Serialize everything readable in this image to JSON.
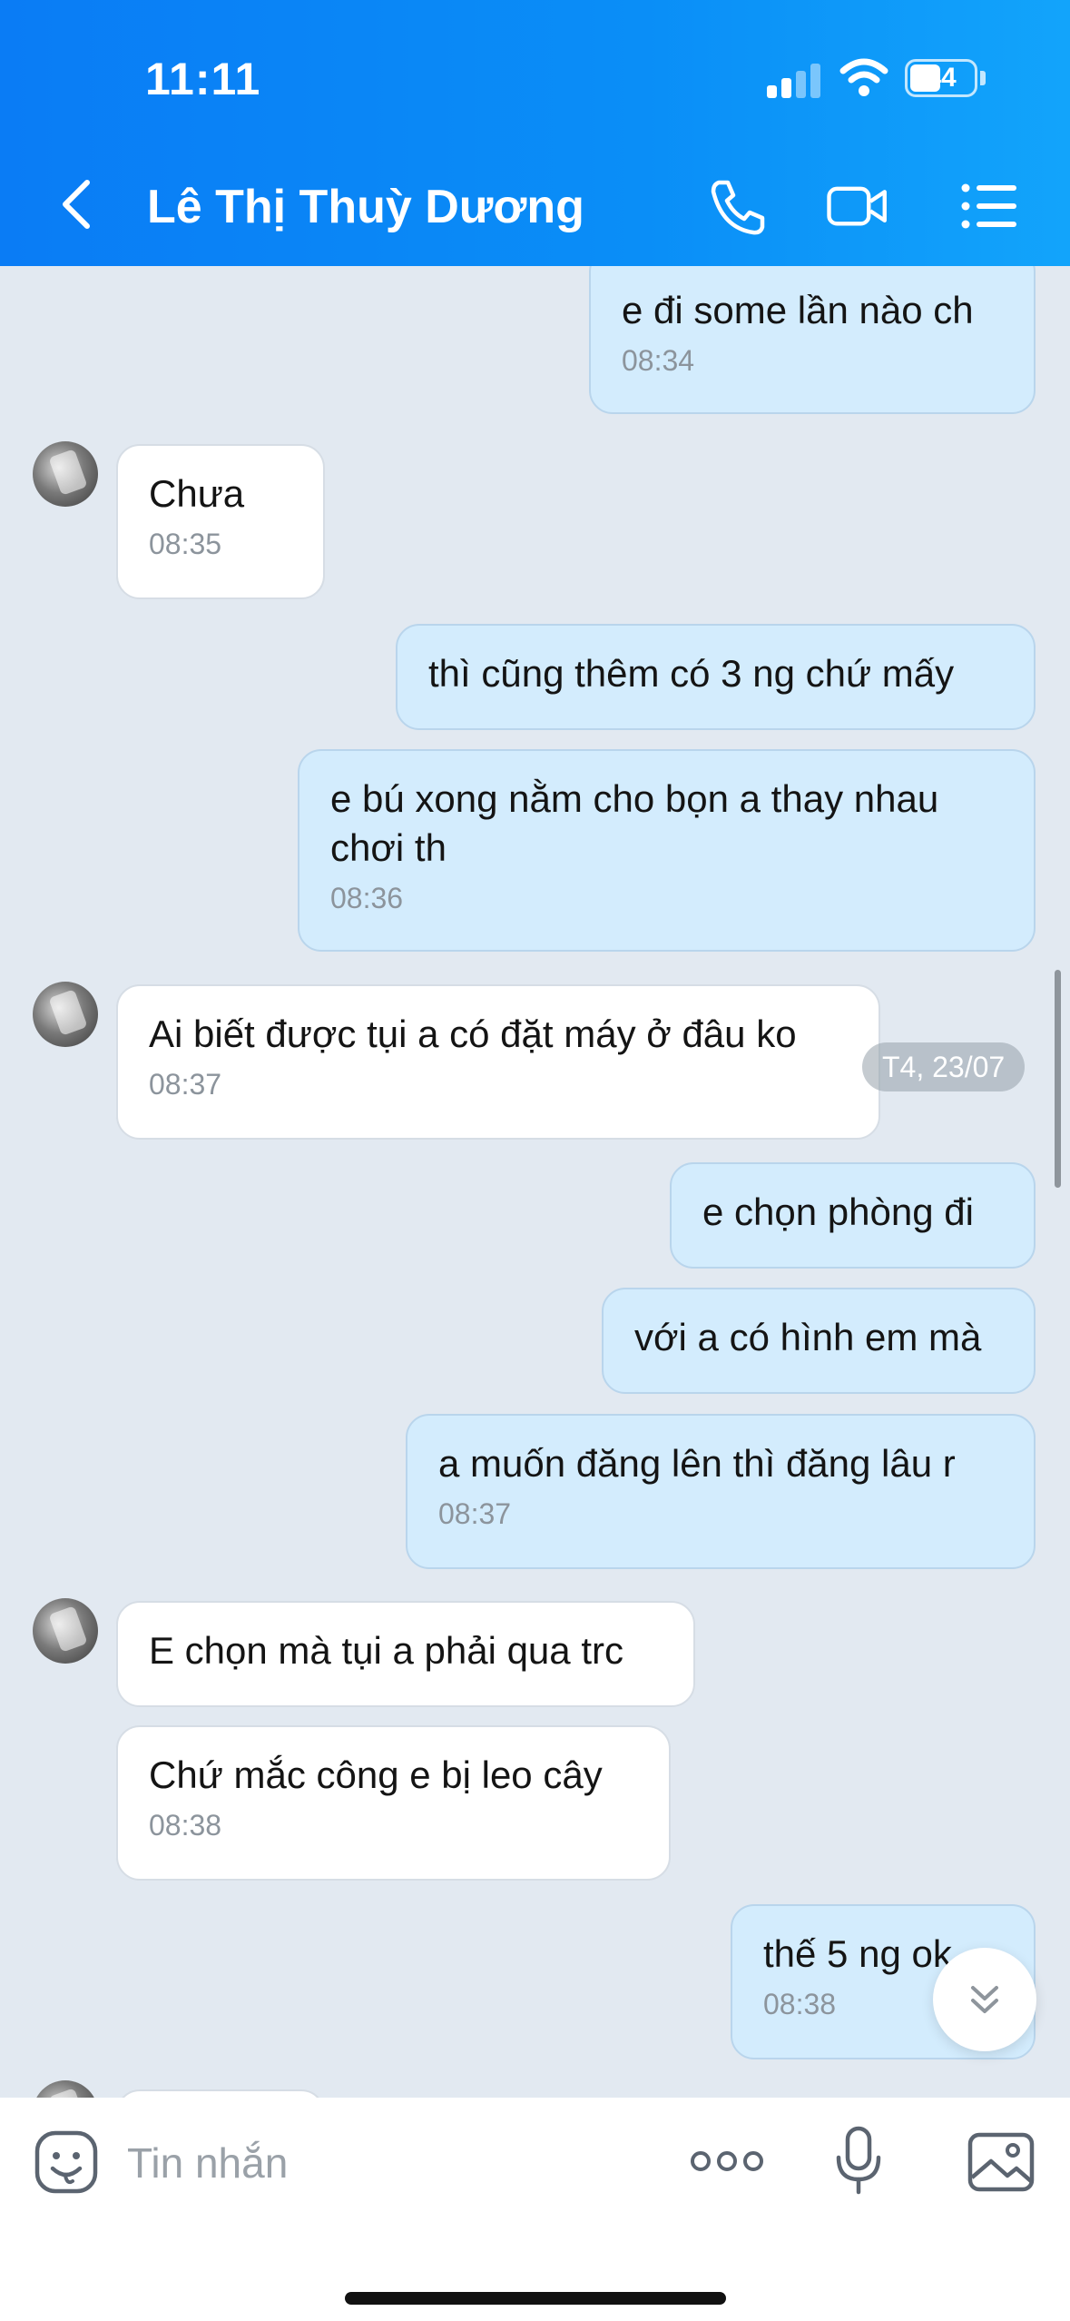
{
  "status_bar": {
    "time": "11:11",
    "battery": "44",
    "battery_level": 0.44
  },
  "header": {
    "contact_name": "Lê Thị Thuỳ Dương",
    "icons": [
      "back-icon",
      "phone-icon",
      "video-call-icon",
      "menu-list-icon"
    ]
  },
  "chat": {
    "date_divider": "T4, 23/07",
    "messages": [
      {
        "dir": "out",
        "text": "e đi some lần nào ch",
        "time": "08:34"
      },
      {
        "dir": "in",
        "text": "Chưa",
        "time": "08:35"
      },
      {
        "dir": "out",
        "text": "thì cũng thêm có 3 ng chứ mấy",
        "time": ""
      },
      {
        "dir": "out",
        "text": "e bú xong nằm cho bọn a thay nhau chơi th",
        "time": "08:36"
      },
      {
        "dir": "in",
        "text": "Ai biết được tụi a có đặt máy ở đâu ko",
        "time": "08:37"
      },
      {
        "dir": "out",
        "text": "e chọn phòng đi",
        "time": ""
      },
      {
        "dir": "out",
        "text": "với a có hình em mà",
        "time": ""
      },
      {
        "dir": "out",
        "text": "a muốn đăng lên thì đăng lâu r",
        "time": "08:37"
      },
      {
        "dir": "in",
        "text": "E chọn mà tụi a phải qua trc",
        "time": ""
      },
      {
        "dir": "in",
        "text": "Chứ mắc công e bị leo cây",
        "time": "08:38"
      },
      {
        "dir": "out",
        "text": "thế 5 ng ok",
        "time": "08:38"
      }
    ]
  },
  "input_bar": {
    "placeholder": "Tin nhắn",
    "icons": [
      "sticker-icon",
      "more-icon",
      "microphone-icon",
      "image-icon"
    ]
  }
}
